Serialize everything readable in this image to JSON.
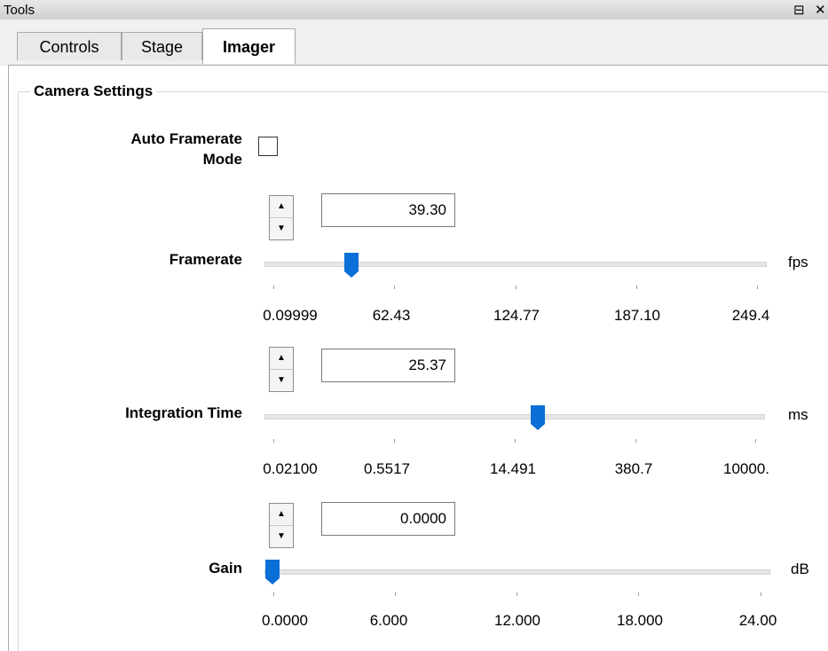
{
  "window": {
    "title": "Tools",
    "float_glyph": "⊟",
    "close_glyph": "✕"
  },
  "tabs": [
    {
      "label": "Controls"
    },
    {
      "label": "Stage"
    },
    {
      "label": "Imager"
    }
  ],
  "active_tab": "Imager",
  "group": {
    "title": "Camera Settings"
  },
  "auto_framerate": {
    "label_line1": "Auto Framerate",
    "label_line2": "Mode",
    "checked": false
  },
  "framerate": {
    "label": "Framerate",
    "value": "39.30",
    "unit": "fps",
    "slider_fraction": 0.157,
    "ticks": [
      "0.09999",
      "62.43",
      "124.77",
      "187.10",
      "249.4"
    ]
  },
  "integration": {
    "label": "Integration Time",
    "value": "25.37",
    "unit": "ms",
    "slider_fraction": 0.53,
    "ticks": [
      "0.02100",
      "0.5517",
      "14.491",
      "380.7",
      "10000."
    ]
  },
  "gain": {
    "label": "Gain",
    "value": "0.0000",
    "unit": "dB",
    "slider_fraction": 0.0,
    "ticks": [
      "0.0000",
      "6.000",
      "12.000",
      "18.000",
      "24.00"
    ]
  },
  "colors": {
    "thumb": "#0a6fd6",
    "track": "#e6e6e6"
  }
}
